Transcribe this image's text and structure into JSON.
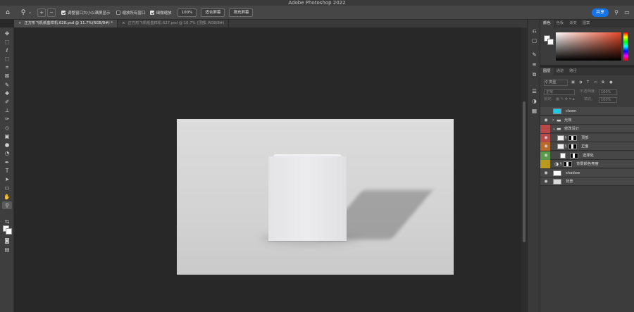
{
  "app": {
    "title": "Adobe Photoshop 2022"
  },
  "options_bar": {
    "resize_windows_label": "调整窗口大小以满屏显示",
    "resize_windows_checked": true,
    "zoom_all_label": "缩放所有窗口",
    "zoom_all_checked": false,
    "scrubby_zoom_label": "细微缩放",
    "scrubby_zoom_checked": true,
    "zoom_value": "100%",
    "fit_screen_label": "适合屏幕",
    "fill_screen_label": "填充屏幕",
    "share_label": "共享"
  },
  "tabs": [
    {
      "label": "正方形飞机纸盒样机.628.psd @ 11.7%(RGB/8#) *",
      "close": "×",
      "active": true
    },
    {
      "label": "正方形飞机纸盒样机.627.psd @ 16.7% (顶部, RGB/8#)",
      "close": "×",
      "active": false
    }
  ],
  "tools": [
    "move-icon",
    "marquee-icon",
    "lasso-icon",
    "object-select-icon",
    "crop-icon",
    "frame-icon",
    "eyedropper-icon",
    "healing-icon",
    "brush-icon",
    "stamp-icon",
    "history-brush-icon",
    "eraser-icon",
    "gradient-icon",
    "blur-icon",
    "dodge-icon",
    "pen-icon",
    "type-icon",
    "path-select-icon",
    "shape-icon",
    "hand-icon",
    "zoom-icon"
  ],
  "color_panel": {
    "tabs": [
      "颜色",
      "色板",
      "渐变",
      "图案"
    ],
    "accent_color": "#e64626"
  },
  "layers_panel": {
    "tabs": [
      "图层",
      "通道",
      "路径"
    ],
    "filter_label": "类型",
    "blend_mode": "正常",
    "opacity_label": "不透明度:",
    "opacity_value": "100%",
    "lock_label": "锁定:",
    "fill_label": "填充:",
    "fill_value": "100%",
    "layers": [
      {
        "name": "clown",
        "visible": false,
        "tag": null
      },
      {
        "name": "光效",
        "visible": true,
        "tag": null
      },
      {
        "name": "修改设计",
        "visible": false,
        "tag": "#b84a4a"
      },
      {
        "name": "顶部",
        "visible": true,
        "tag": "#b84a4a"
      },
      {
        "name": "正面",
        "visible": true,
        "tag": "#b86a2a"
      },
      {
        "name": "选择处",
        "visible": true,
        "tag": "#5a9a4a"
      },
      {
        "name": "背景颜色亮度",
        "visible": false,
        "tag": "#b89a20"
      },
      {
        "name": "shadow",
        "visible": true,
        "tag": null
      },
      {
        "name": "背景",
        "visible": true,
        "tag": null
      }
    ]
  }
}
